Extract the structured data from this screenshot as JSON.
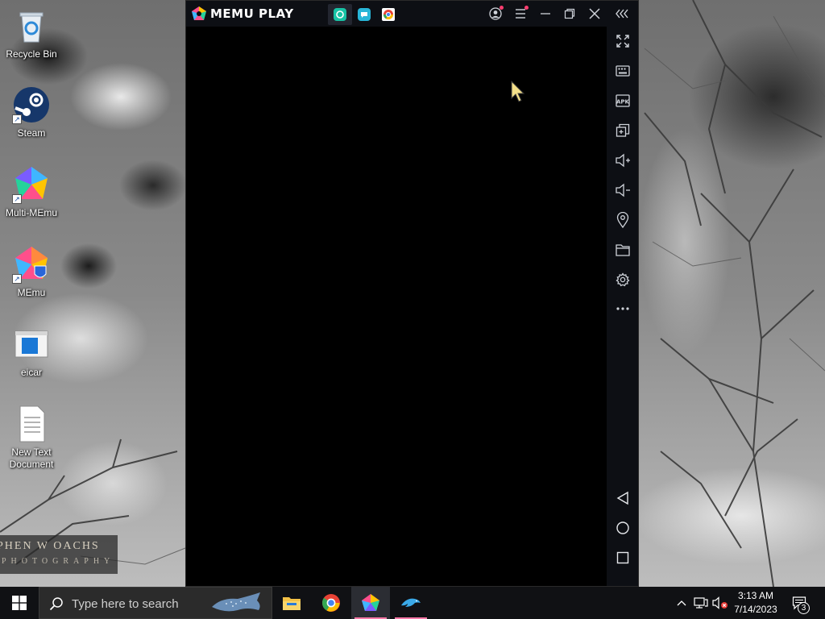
{
  "desktop": {
    "icons": [
      {
        "label": "Recycle Bin",
        "icon": "recycle-bin-icon"
      },
      {
        "label": "Steam",
        "icon": "steam-icon"
      },
      {
        "label": "Multi-MEmu",
        "icon": "multi-memu-icon"
      },
      {
        "label": "MEmu",
        "icon": "memu-icon"
      },
      {
        "label": "eicar",
        "icon": "eicar-window-icon"
      },
      {
        "label": "New Text Document",
        "icon": "text-document-icon"
      }
    ],
    "watermark": {
      "line1": "PHEN W OACHS",
      "line2": "PHOTOGRAPHY"
    }
  },
  "memu": {
    "logo_text": "MEMU PLAY",
    "tabs": [
      {
        "icon": "android-app-icon",
        "color": "#17c3a5"
      },
      {
        "icon": "chat-app-icon",
        "color": "#28b6d8"
      },
      {
        "icon": "chrome-icon",
        "color": "#e94235"
      }
    ],
    "title_controls": [
      "account-icon",
      "menu-icon",
      "minimize-icon",
      "restore-icon",
      "close-icon",
      "collapse-sidebar-icon"
    ],
    "sidebar": [
      "fullscreen-icon",
      "keyboard-mapping-icon",
      "apk-install-icon",
      "multi-window-icon",
      "volume-up-icon",
      "volume-down-icon",
      "location-icon",
      "folder-icon",
      "settings-icon",
      "more-icon",
      "back-icon",
      "home-icon",
      "recent-apps-icon"
    ],
    "apk_label": "APK"
  },
  "taskbar": {
    "search_placeholder": "Type here to search",
    "apps": [
      "file-explorer-icon",
      "chrome-icon",
      "memu-icon",
      "dolphin-emulator-icon"
    ],
    "time": "3:13 AM",
    "date": "7/14/2023",
    "notification_count": "3"
  },
  "colors": {
    "memu_titlebar": "#0d0f14",
    "taskbar": "#101114",
    "active_app_underline": "#ff7aa8"
  }
}
